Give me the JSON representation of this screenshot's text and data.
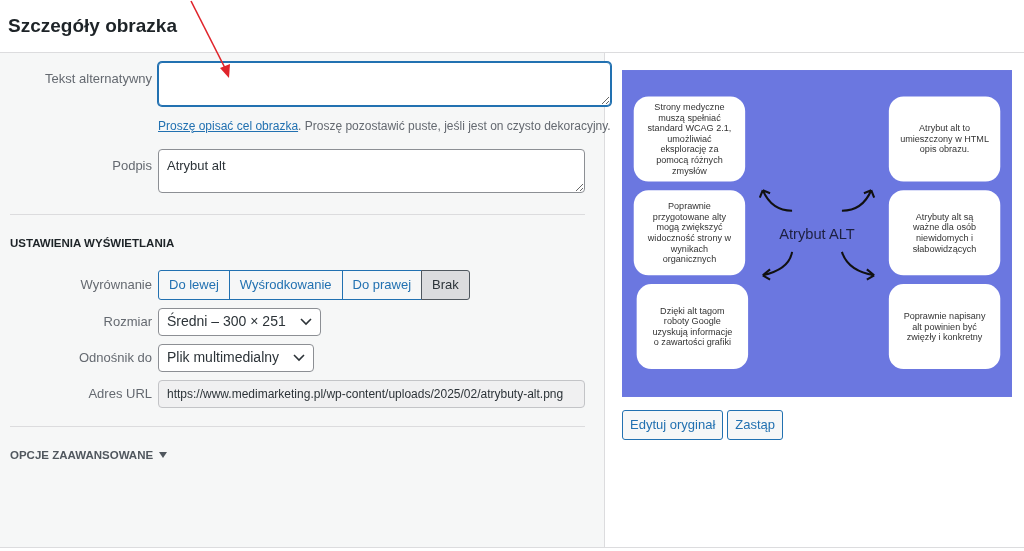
{
  "title": "Szczegóły obrazka",
  "alt_text": {
    "label": "Tekst alternatywny",
    "focused": true,
    "help_link": "Proszę opisać cel obrazka",
    "help": ". Proszę pozostawić puste, jeśli jest on czysto dekoracyjny."
  },
  "caption": {
    "label": "Podpis",
    "value": "Atrybut alt"
  },
  "display_settings": {
    "heading": "USTAWIENIA WYŚWIETLANIA",
    "alignment": {
      "label": "Wyrównanie",
      "options": [
        {
          "label": "Do lewej",
          "selected": false
        },
        {
          "label": "Wyśrodkowanie",
          "selected": false
        },
        {
          "label": "Do prawej",
          "selected": false
        },
        {
          "label": "Brak",
          "selected": true
        }
      ]
    },
    "size": {
      "label": "Rozmiar",
      "value": "Średni – 300 × 251"
    },
    "link_to": {
      "label": "Odnośnik do",
      "value": "Plik multimedialny"
    },
    "url": {
      "label": "Adres URL",
      "value": "https://www.medimarketing.pl/wp-content/uploads/2025/02/atrybuty-alt.png"
    }
  },
  "advanced": {
    "label": "OPCJE ZAAWANSOWANE",
    "expanded": false
  },
  "preview": {
    "diagram": {
      "center": "Atrybut ALT",
      "left": [
        "Strony medyczne muszą spełniać standard WCAG 2.1, umożliwiać eksplorację za pomocą różnych zmysłów",
        "Poprawnie przygotowane alty mogą zwiększyć widoczność strony w wynikach organicznych",
        "Dzięki alt tagom roboty Google uzyskują informacje o zawartości grafiki"
      ],
      "right": [
        "Atrybut alt to umieszczony w HTML opis obrazu.",
        "Atrybuty alt są ważne dla osób niewidomych i słabowidzących",
        "Poprawnie napisany alt powinien być zwięzły i konkretny"
      ]
    },
    "buttons": [
      "Edytuj oryginał",
      "Zastąp"
    ]
  }
}
